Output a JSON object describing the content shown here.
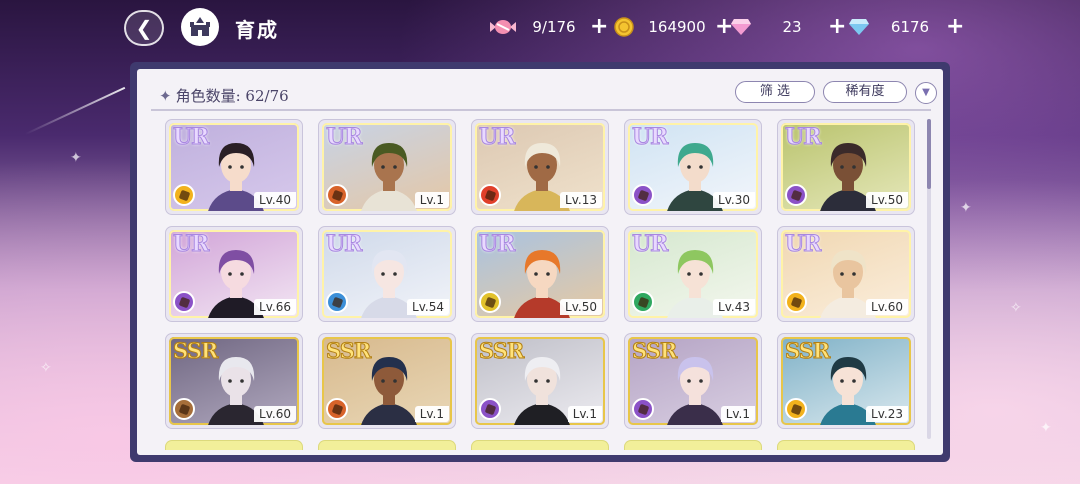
{
  "header": {
    "back_icon": "back-arrow-icon",
    "home_icon": "castle-icon",
    "title": "育成",
    "resources": [
      {
        "name": "candy",
        "icon": "candy-icon",
        "value": "9/176",
        "plus": "+"
      },
      {
        "name": "coin",
        "icon": "coin-icon",
        "value": "164900",
        "plus": "+"
      },
      {
        "name": "pink-gem",
        "icon": "pink-diamond-icon",
        "value": "23",
        "plus": "+"
      },
      {
        "name": "blue-gem",
        "icon": "blue-diamond-icon",
        "value": "6176",
        "plus": "+"
      }
    ]
  },
  "panel": {
    "count_prefix": "角色数量:",
    "count_value": "62/76",
    "filter_label": "筛 选",
    "sort_label": "稀有度",
    "sort_toggle_icon": "chevron-down-icon",
    "scroll_position": 0
  },
  "characters": [
    {
      "rarity": "UR",
      "level": "Lv.40",
      "attr_color": "#f2b21c",
      "bg": [
        "#bfb0dd",
        "#d7c9ec"
      ],
      "hair": "#2a1f25",
      "skin": "#f6dccb",
      "outfit": "#5c4b8a"
    },
    {
      "rarity": "UR",
      "level": "Lv.1",
      "attr_color": "#d8632a",
      "bg": [
        "#c7d3e6",
        "#e5c7a5"
      ],
      "hair": "#4a5a22",
      "skin": "#a9744e",
      "outfit": "#e8e3d6"
    },
    {
      "rarity": "UR",
      "level": "Lv.13",
      "attr_color": "#e0402a",
      "bg": [
        "#dcc8b2",
        "#f0e2cc"
      ],
      "hair": "#efe9da",
      "skin": "#a06a45",
      "outfit": "#d8b65a"
    },
    {
      "rarity": "UR",
      "level": "Lv.30",
      "attr_color": "#8b52c7",
      "bg": [
        "#cfe3f3",
        "#f3f6fb"
      ],
      "hair": "#3fa98e",
      "skin": "#f3dccb",
      "outfit": "#2f4640"
    },
    {
      "rarity": "UR",
      "level": "Lv.50",
      "attr_color": "#8b52c7",
      "bg": [
        "#b9c36d",
        "#e6e8bb"
      ],
      "hair": "#3a2a2a",
      "skin": "#7a5036",
      "outfit": "#2c2d3a"
    },
    {
      "rarity": "UR",
      "level": "Lv.66",
      "attr_color": "#8b52c7",
      "bg": [
        "#d1a4d8",
        "#f3e6f3"
      ],
      "hair": "#7f4ea3",
      "skin": "#f6dbe0",
      "outfit": "#1f1b26"
    },
    {
      "rarity": "UR",
      "level": "Lv.54",
      "attr_color": "#3c8fd8",
      "bg": [
        "#cfd9ea",
        "#f2f4f9"
      ],
      "hair": "#e2e6f2",
      "skin": "#f6e6e2",
      "outfit": "#d7dae8"
    },
    {
      "rarity": "UR",
      "level": "Lv.50",
      "attr_color": "#e2c22c",
      "bg": [
        "#a8c3e2",
        "#e7c9a2"
      ],
      "hair": "#e7782a",
      "skin": "#f6d8c1",
      "outfit": "#b53a2a"
    },
    {
      "rarity": "UR",
      "level": "Lv.43",
      "attr_color": "#2fa860",
      "bg": [
        "#d5e8cf",
        "#f4f7ee"
      ],
      "hair": "#8ec760",
      "skin": "#f6e2d6",
      "outfit": "#e9efe9"
    },
    {
      "rarity": "UR",
      "level": "Lv.60",
      "attr_color": "#f2b21c",
      "bg": [
        "#f0d7b2",
        "#fbeedc"
      ],
      "hair": "#efe3c8",
      "skin": "#e9c59f",
      "outfit": "#f4ece0"
    },
    {
      "rarity": "SSR",
      "level": "Lv.60",
      "attr_color": "#a66e3a",
      "bg": [
        "#6f6681",
        "#b1a9bf"
      ],
      "hair": "#e8e8ee",
      "skin": "#eae2e8",
      "outfit": "#2a2630"
    },
    {
      "rarity": "SSR",
      "level": "Lv.1",
      "attr_color": "#d8632a",
      "bg": [
        "#d7b98d",
        "#e9d7b6"
      ],
      "hair": "#23304d",
      "skin": "#8e5a3a",
      "outfit": "#2b2f44"
    },
    {
      "rarity": "SSR",
      "level": "Lv.1",
      "attr_color": "#8b52c7",
      "bg": [
        "#bfbfc8",
        "#ecebf0"
      ],
      "hair": "#eeeef2",
      "skin": "#f0e2dc",
      "outfit": "#1f1f24"
    },
    {
      "rarity": "SSR",
      "level": "Lv.1",
      "attr_color": "#8b52c7",
      "bg": [
        "#b4a3c4",
        "#d9cfe2"
      ],
      "hair": "#c9c2ec",
      "skin": "#f5e1dc",
      "outfit": "#3a2e4a"
    },
    {
      "rarity": "SSR",
      "level": "Lv.23",
      "attr_color": "#f2b21c",
      "bg": [
        "#7fb1c7",
        "#d9e8ee"
      ],
      "hair": "#1f3a44",
      "skin": "#f6e2d6",
      "outfit": "#2a7a92"
    }
  ]
}
